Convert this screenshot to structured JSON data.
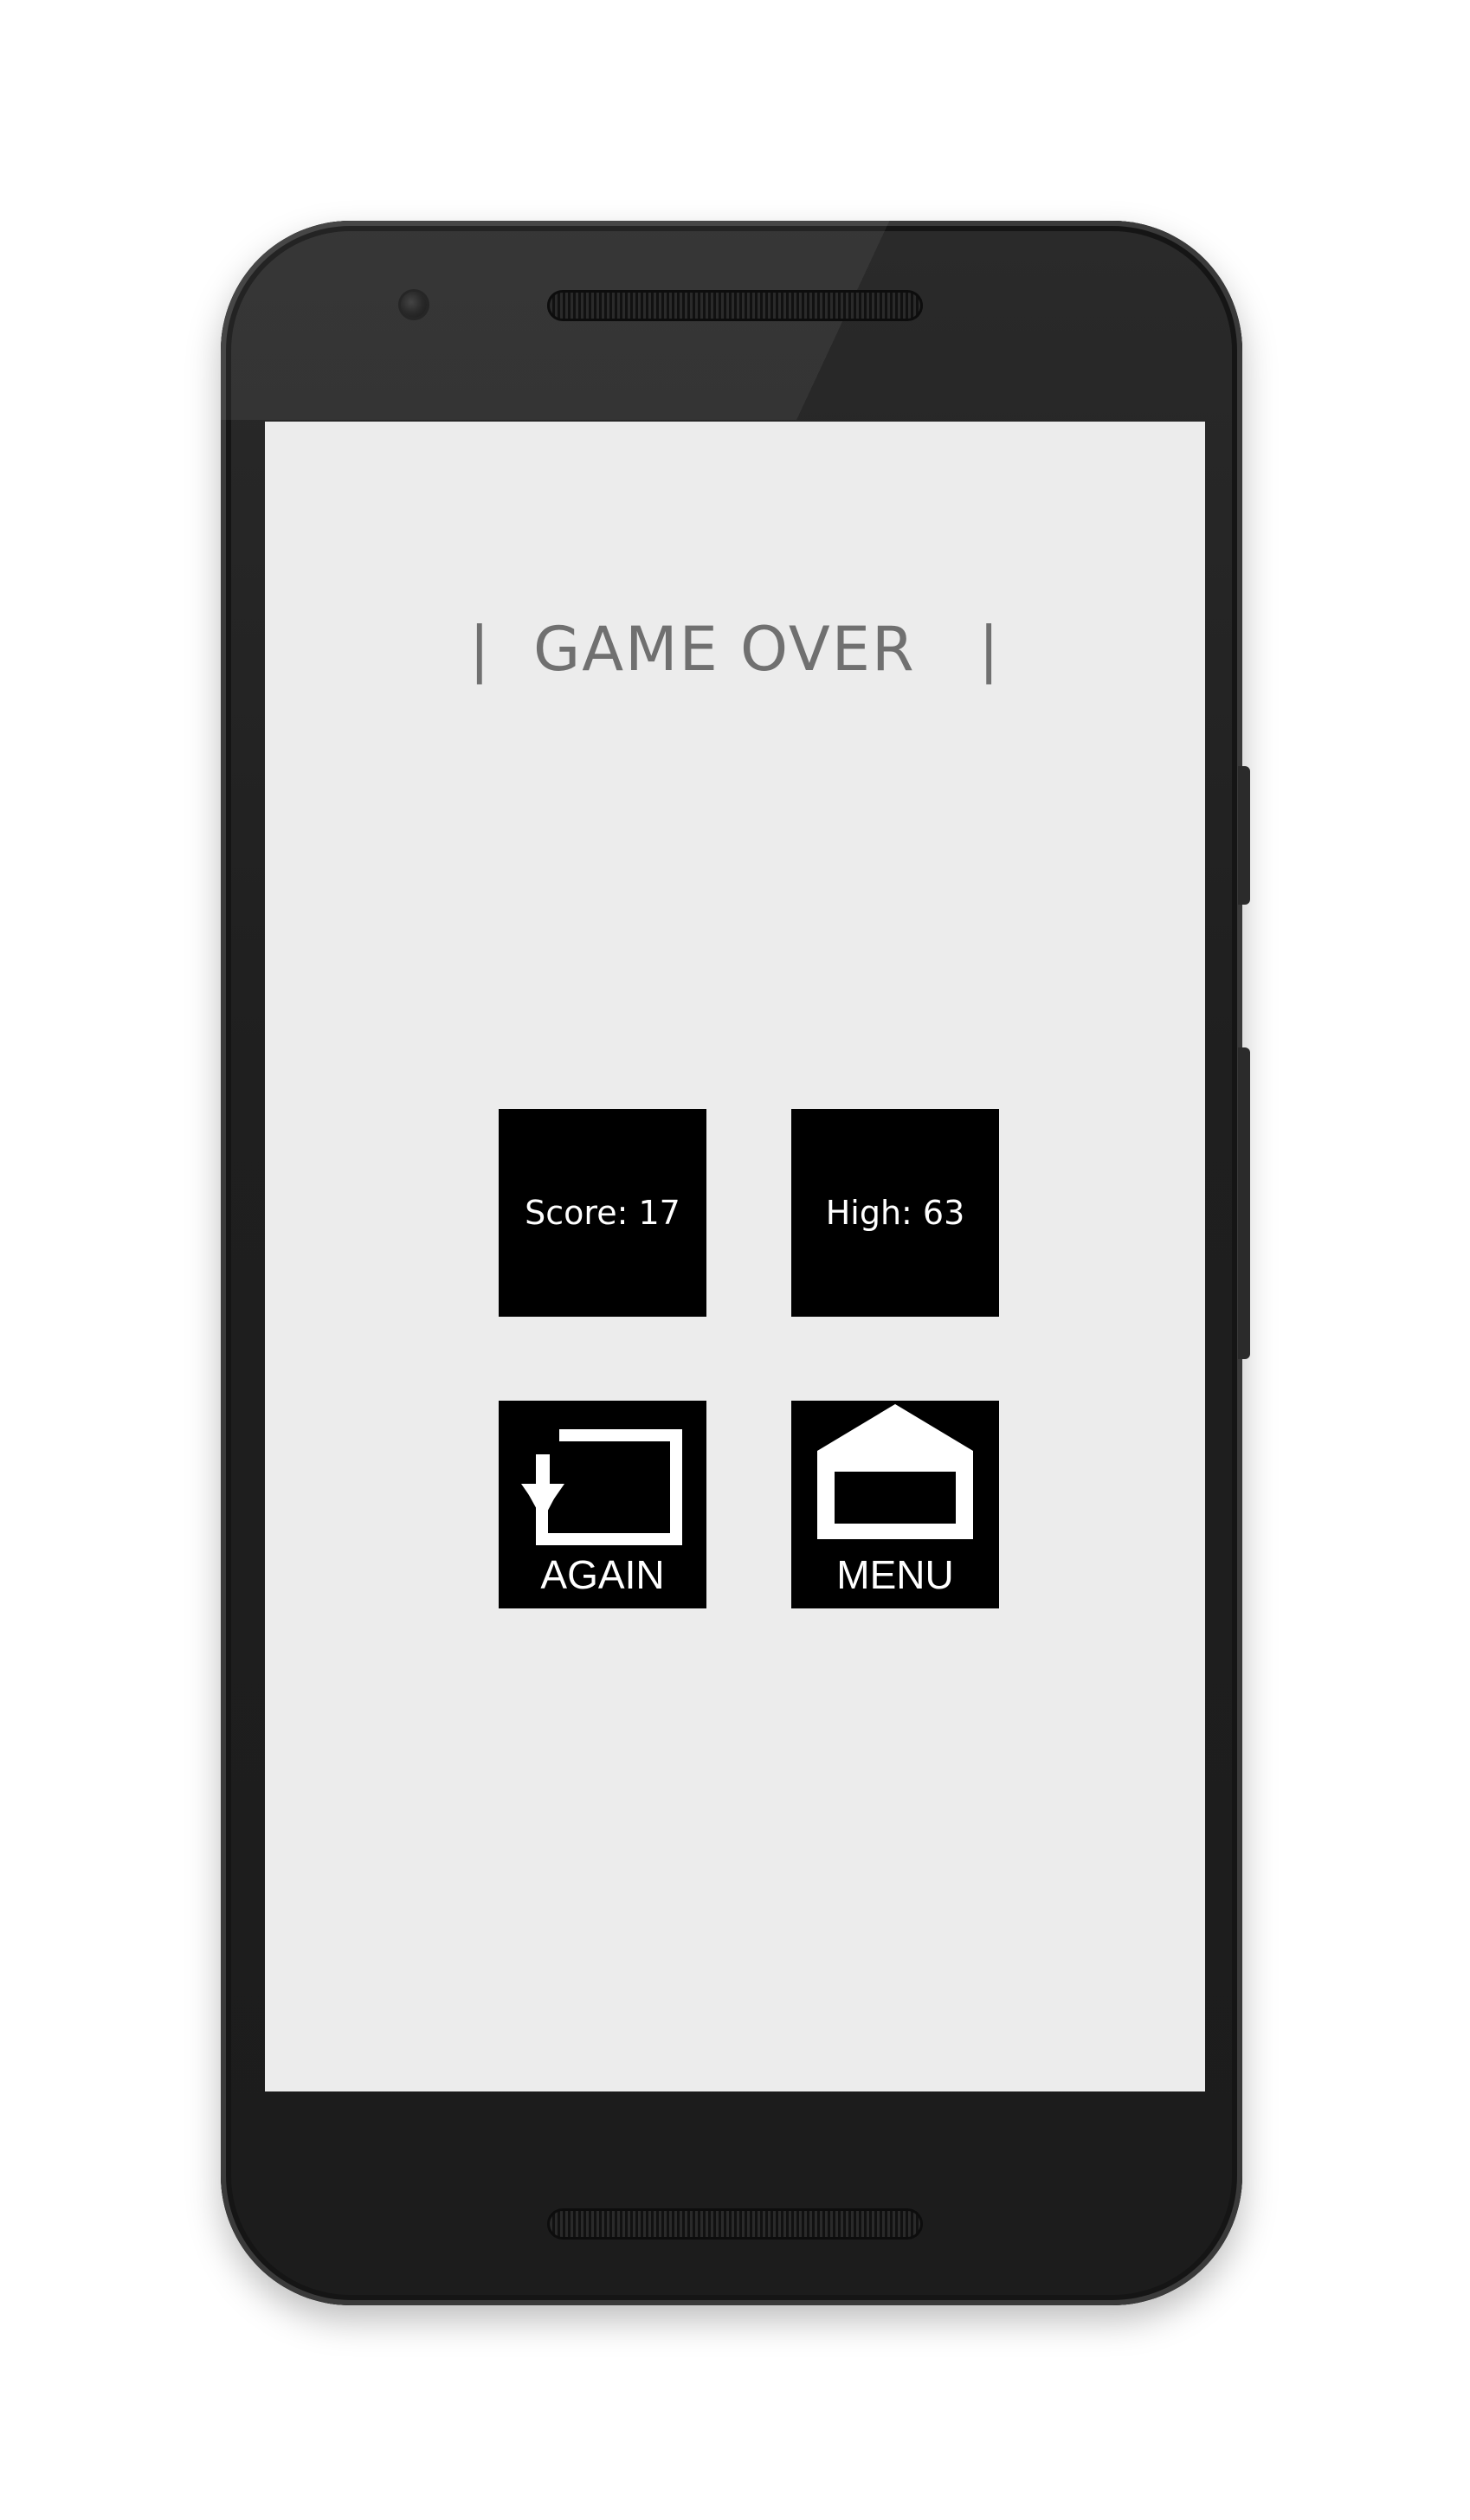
{
  "game_over": {
    "title": "|  GAME OVER   |"
  },
  "stats": {
    "score_label": "Score: 17",
    "high_label": "High: 63"
  },
  "buttons": {
    "again_label": "AGAIN",
    "again_icon": "replay-icon",
    "menu_label": "MENU",
    "menu_icon": "home-icon"
  },
  "colors": {
    "screen_background": "#ececec",
    "tile_background": "#000000",
    "tile_text": "#ffffff",
    "title_text": "#707070"
  }
}
